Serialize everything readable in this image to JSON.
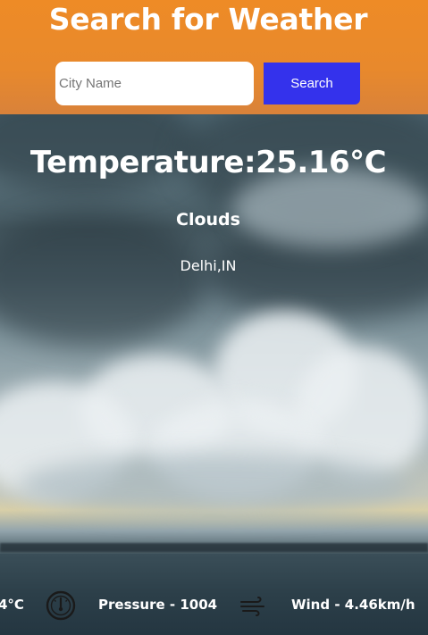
{
  "header": {
    "title": "Search for Weather",
    "search_placeholder": "City Name",
    "search_value": "",
    "search_button_label": "Search"
  },
  "weather": {
    "temperature_text": "Temperature:25.16°C",
    "condition": "Clouds",
    "location": "Delhi,IN"
  },
  "stats": {
    "feels_like_partial": "4°C",
    "pressure_text": "Pressure - 1004",
    "wind_text": "Wind - 4.46km/h",
    "pressure_icon": "gauge-icon",
    "wind_icon": "wind-icon"
  },
  "colors": {
    "header_bg": "#ee8b26",
    "search_button_bg": "#3432ec",
    "text": "#ffffff"
  }
}
